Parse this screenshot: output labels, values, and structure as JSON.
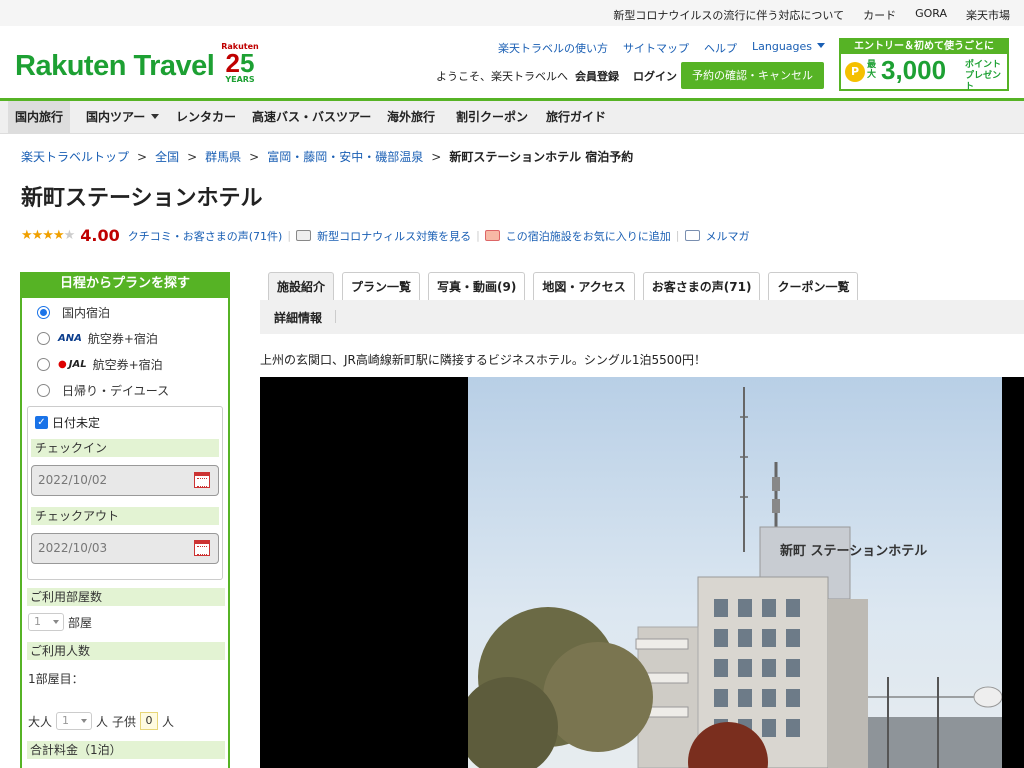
{
  "topbar": {
    "links": [
      "新型コロナウイルスの流行に伴う対応について",
      "カード",
      "GORA",
      "楽天市場"
    ]
  },
  "header": {
    "logo": "Rakuten Travel",
    "anniv_brand": "Rakuten",
    "anniv_num_a": "2",
    "anniv_num_b": "5",
    "anniv_years": "YEARS",
    "links": [
      "楽天トラベルの使い方",
      "サイトマップ",
      "ヘルプ",
      "Languages"
    ],
    "welcome": "ようこそ、楽天トラベルへ",
    "member": "会員登録",
    "login": "ログイン",
    "reserve": "予約の確認・キャンセル",
    "promo_top": "エントリー＆初めて使うごとに",
    "promo_max": "最大",
    "promo_amount": "3,000",
    "promo_unit": "ポイント",
    "promo_present": "プレゼント",
    "promo_coin": "P"
  },
  "nav": [
    "国内旅行",
    "国内ツアー",
    "レンタカー",
    "高速バス・バスツアー",
    "海外旅行",
    "割引クーポン",
    "旅行ガイド"
  ],
  "breadcrumb": [
    "楽天トラベルトップ",
    "全国",
    "群馬県",
    "富岡・藤岡・安中・磯部温泉",
    "新町ステーションホテル 宿泊予約"
  ],
  "breadcrumb_sep": ">",
  "hotel": {
    "name": "新町ステーションホテル",
    "stars_full": "★★★★",
    "stars_empty": "★",
    "score": "4.00",
    "reviews": "クチコミ・お客さまの声(71件)",
    "covid": "新型コロナウィルス対策を見る",
    "favorite": "この宿泊施設をお気に入りに追加",
    "mail": "メルマガ",
    "intro": "上州の玄関口、JR高崎線新町駅に隣接するビジネスホテル。シングル1泊5500円！"
  },
  "search": {
    "title": "日程からプランを探す",
    "options": [
      "国内宿泊",
      "航空券+宿泊",
      "航空券+宿泊",
      "日帰り・デイユース"
    ],
    "ana": "ANA",
    "jal": "JAL",
    "undecided": "日付未定",
    "checkin_label": "チェックイン",
    "checkin": "2022/10/02",
    "checkout_label": "チェックアウト",
    "checkout": "2022/10/03",
    "rooms_label": "ご利用部屋数",
    "rooms": "1",
    "rooms_unit": "部屋",
    "people_label": "ご利用人数",
    "room1": "1部屋目：",
    "adult_label": "大人",
    "adults": "1",
    "person_unit": "人",
    "child_label": "子供",
    "children": "0",
    "total_label": "合計料金（1泊）"
  },
  "tabs": [
    "施設紹介",
    "プラン一覧",
    "写真・動画(9)",
    "地図・アクセス",
    "お客さまの声(71)",
    "クーポン一覧"
  ],
  "subtab": "詳細情報",
  "photo_sign": "新町 ステーションホテル"
}
